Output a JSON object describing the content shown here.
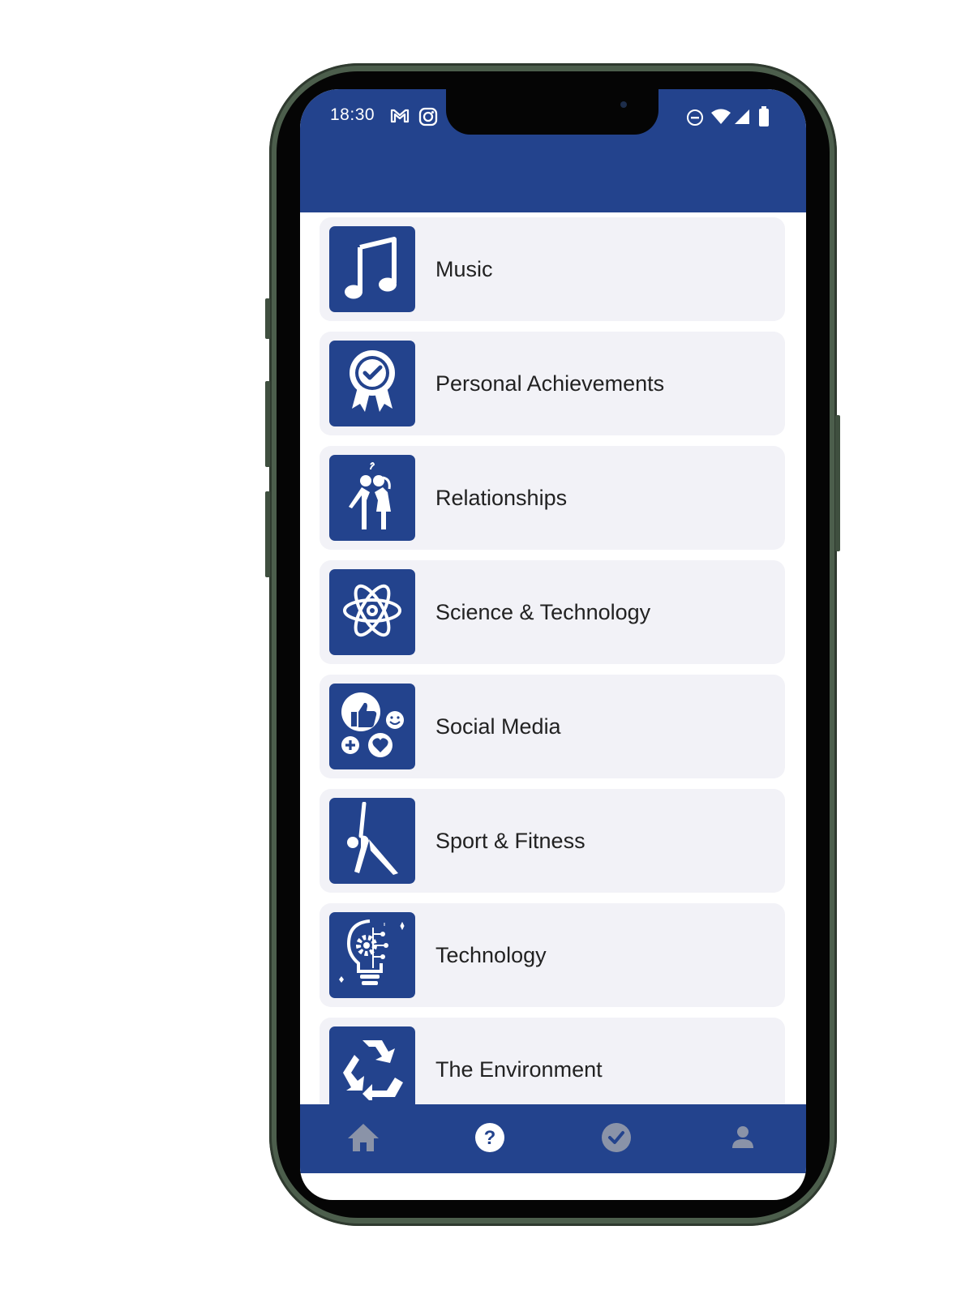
{
  "status_bar": {
    "time": "18:30"
  },
  "categories": [
    {
      "label": "Music",
      "icon": "music-note-icon"
    },
    {
      "label": "Personal Achievements",
      "icon": "award-badge-icon"
    },
    {
      "label": "Relationships",
      "icon": "couple-icon"
    },
    {
      "label": "Science & Technology",
      "icon": "atom-icon"
    },
    {
      "label": "Social Media",
      "icon": "social-reactions-icon"
    },
    {
      "label": "Sport & Fitness",
      "icon": "yoga-pose-icon"
    },
    {
      "label": "Technology",
      "icon": "lightbulb-gear-icon"
    },
    {
      "label": "The Environment",
      "icon": "recycle-icon"
    }
  ],
  "bottom_nav": [
    {
      "name": "home",
      "icon": "home-icon",
      "active": false
    },
    {
      "name": "questions",
      "icon": "question-circle-icon",
      "active": true
    },
    {
      "name": "completed",
      "icon": "check-circle-icon",
      "active": false
    },
    {
      "name": "profile",
      "icon": "person-icon",
      "active": false
    }
  ],
  "colors": {
    "brand": "#23438d",
    "card": "#f2f2f7",
    "text": "#222222",
    "inactive_icon": "#8a93a8"
  }
}
